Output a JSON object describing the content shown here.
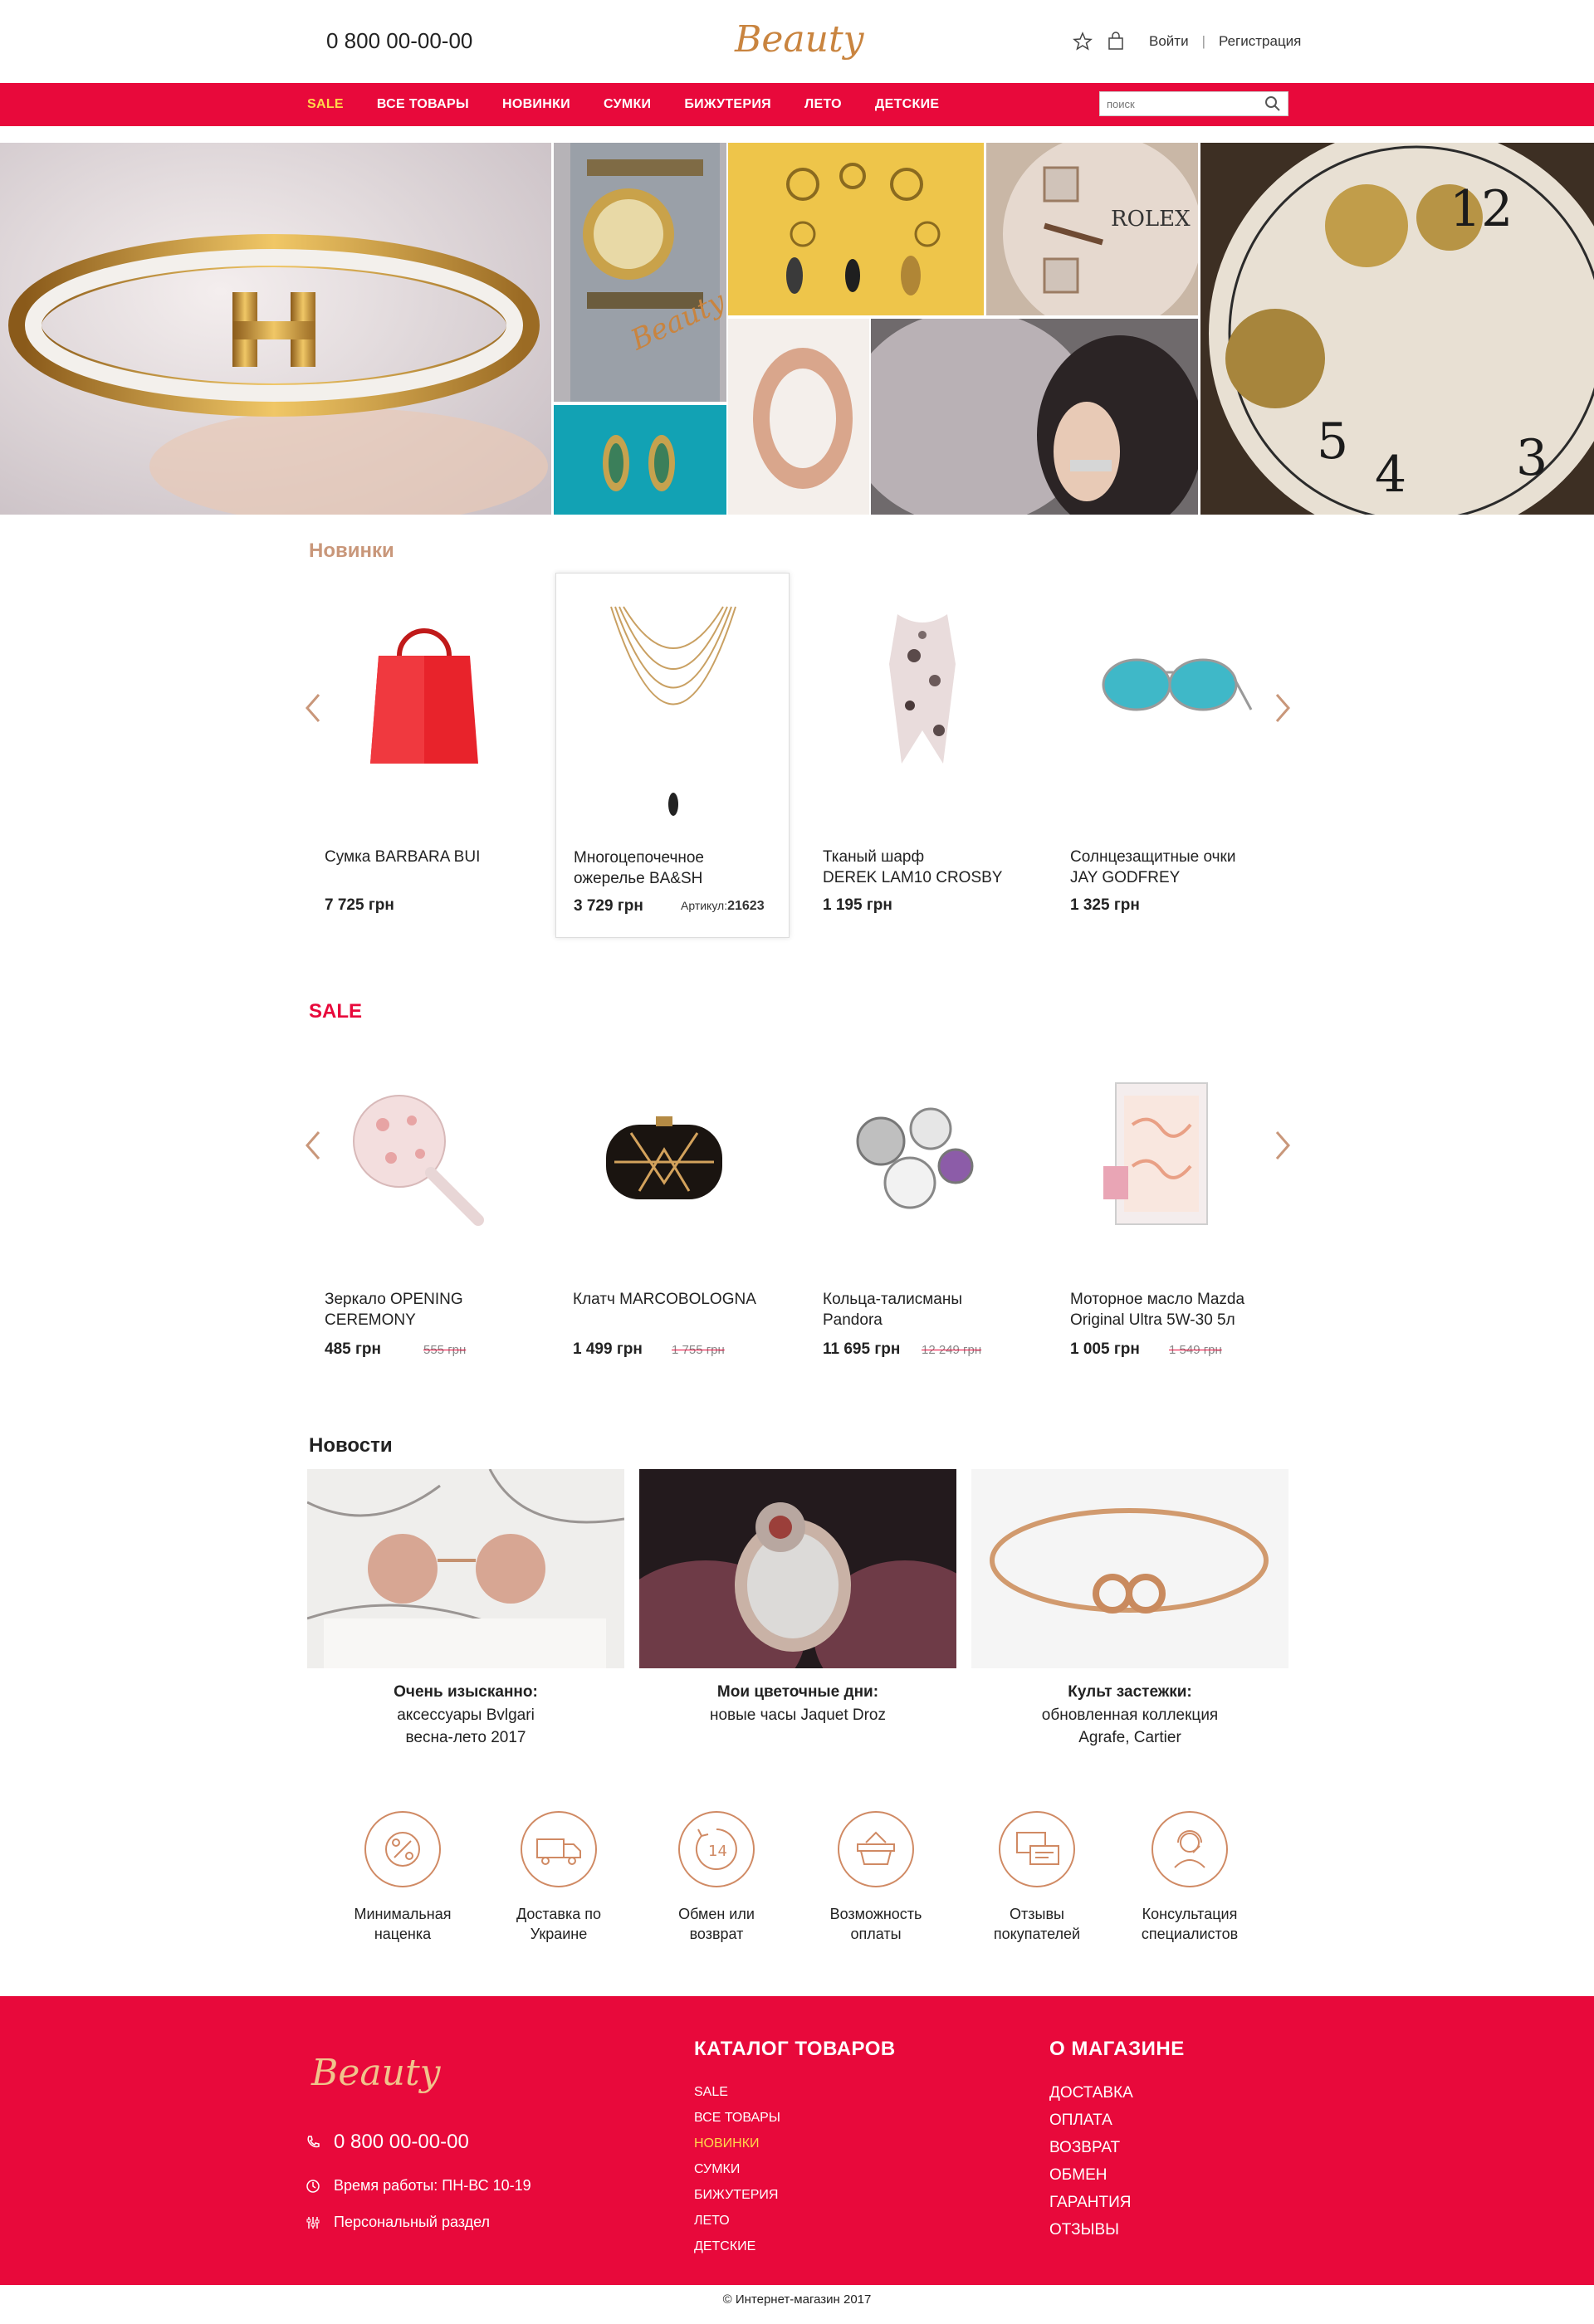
{
  "header": {
    "phone": "0 800 00-00-00",
    "logo_text": "Beauty",
    "login": "Войти",
    "separator": "|",
    "register": "Регистрация",
    "icons": [
      "star-icon",
      "bag-icon"
    ]
  },
  "nav": {
    "items": [
      "SALE",
      "ВСЕ ТОВАРЫ",
      "НОВИНКИ",
      "СУМКИ",
      "БИЖУТЕРИЯ",
      "ЛЕТО",
      "ДЕТСКИЕ"
    ],
    "search_placeholder": "поиск"
  },
  "hero": {
    "watermark": "Beauty",
    "watch_brand": "ROLEX"
  },
  "new_section": {
    "title": "Новинки",
    "products": [
      {
        "name_line1": "Сумка BARBARA BUI",
        "name_line2": "",
        "price": "7 725 грн"
      },
      {
        "name_line1": "Многоцепочечное",
        "name_line2": "ожерелье BA&SH",
        "price": "3 729 грн",
        "sku_label": "Артикул:",
        "sku": "21623"
      },
      {
        "name_line1": "Тканый шарф",
        "name_line2": "DEREK LAM10 CROSBY",
        "price": "1 195 грн"
      },
      {
        "name_line1": "Солнцезащитные очки",
        "name_line2": "JAY GODFREY",
        "price": "1 325 грн"
      }
    ]
  },
  "sale_section": {
    "title": "SALE",
    "products": [
      {
        "name_line1": "Зеркало OPENING",
        "name_line2": "CEREMONY",
        "price": "485 грн",
        "old_price": "555 грн"
      },
      {
        "name_line1": "Клатч MARCOBOLOGNA",
        "name_line2": "",
        "price": "1 499 грн",
        "old_price": "1 755 грн"
      },
      {
        "name_line1": "Кольца-талисманы",
        "name_line2": "Pandora",
        "price": "11  695 грн",
        "old_price": "12 249 грн"
      },
      {
        "name_line1": "Моторное масло Mazda",
        "name_line2": "Original Ultra 5W-30 5л",
        "price": "1 005 грн",
        "old_price": "1 549 грн"
      }
    ]
  },
  "news_section": {
    "title": "Новости",
    "items": [
      {
        "title": "Очень изысканно:",
        "line1": "аксессуары Bvlgari",
        "line2": "весна-лето 2017"
      },
      {
        "title": "Мои цветочные дни:",
        "line1": "новые часы Jaquet Droz",
        "line2": ""
      },
      {
        "title": "Культ застежки:",
        "line1": "обновленная коллекция",
        "line2": "Agrafe, Cartier"
      }
    ]
  },
  "features": [
    {
      "icon": "percent-icon",
      "line1": "Минимальная",
      "line2": "наценка"
    },
    {
      "icon": "truck-icon",
      "line1": "Доставка по",
      "line2": "Украине"
    },
    {
      "icon": "return-14-icon",
      "line1": "Обмен или",
      "line2": "возврат"
    },
    {
      "icon": "basket-icon",
      "line1": "Возможность",
      "line2": "оплаты"
    },
    {
      "icon": "chat-icon",
      "line1": "Отзывы",
      "line2": "покупателей"
    },
    {
      "icon": "support-icon",
      "line1": "Консультация",
      "line2": "специалистов"
    }
  ],
  "footer": {
    "logo_text": "Beauty",
    "phone": "0 800 00-00-00",
    "hours": "Время работы: ПН-ВС 10-19",
    "personal": "Персональный раздел",
    "catalog_title": "КАТАЛОГ ТОВАРОВ",
    "catalog_items": [
      "SALE",
      "ВСЕ ТОВАРЫ",
      "НОВИНКИ",
      "СУМКИ",
      "БИЖУТЕРИЯ",
      "ЛЕТО",
      "ДЕТСКИЕ"
    ],
    "about_title": "О МАГАЗИНЕ",
    "about_items": [
      "ДОСТАВКА",
      "ОПЛАТА",
      "ВОЗВРАТ",
      "ОБМЕН",
      "ГАРАНТИЯ",
      "ОТЗЫВЫ"
    ],
    "copyright": "© Интернет-магазин  2017"
  },
  "colors": {
    "brand_red": "#e8093b",
    "sale_yellow": "#ffd84a",
    "accent_gold": "#c9977a"
  }
}
